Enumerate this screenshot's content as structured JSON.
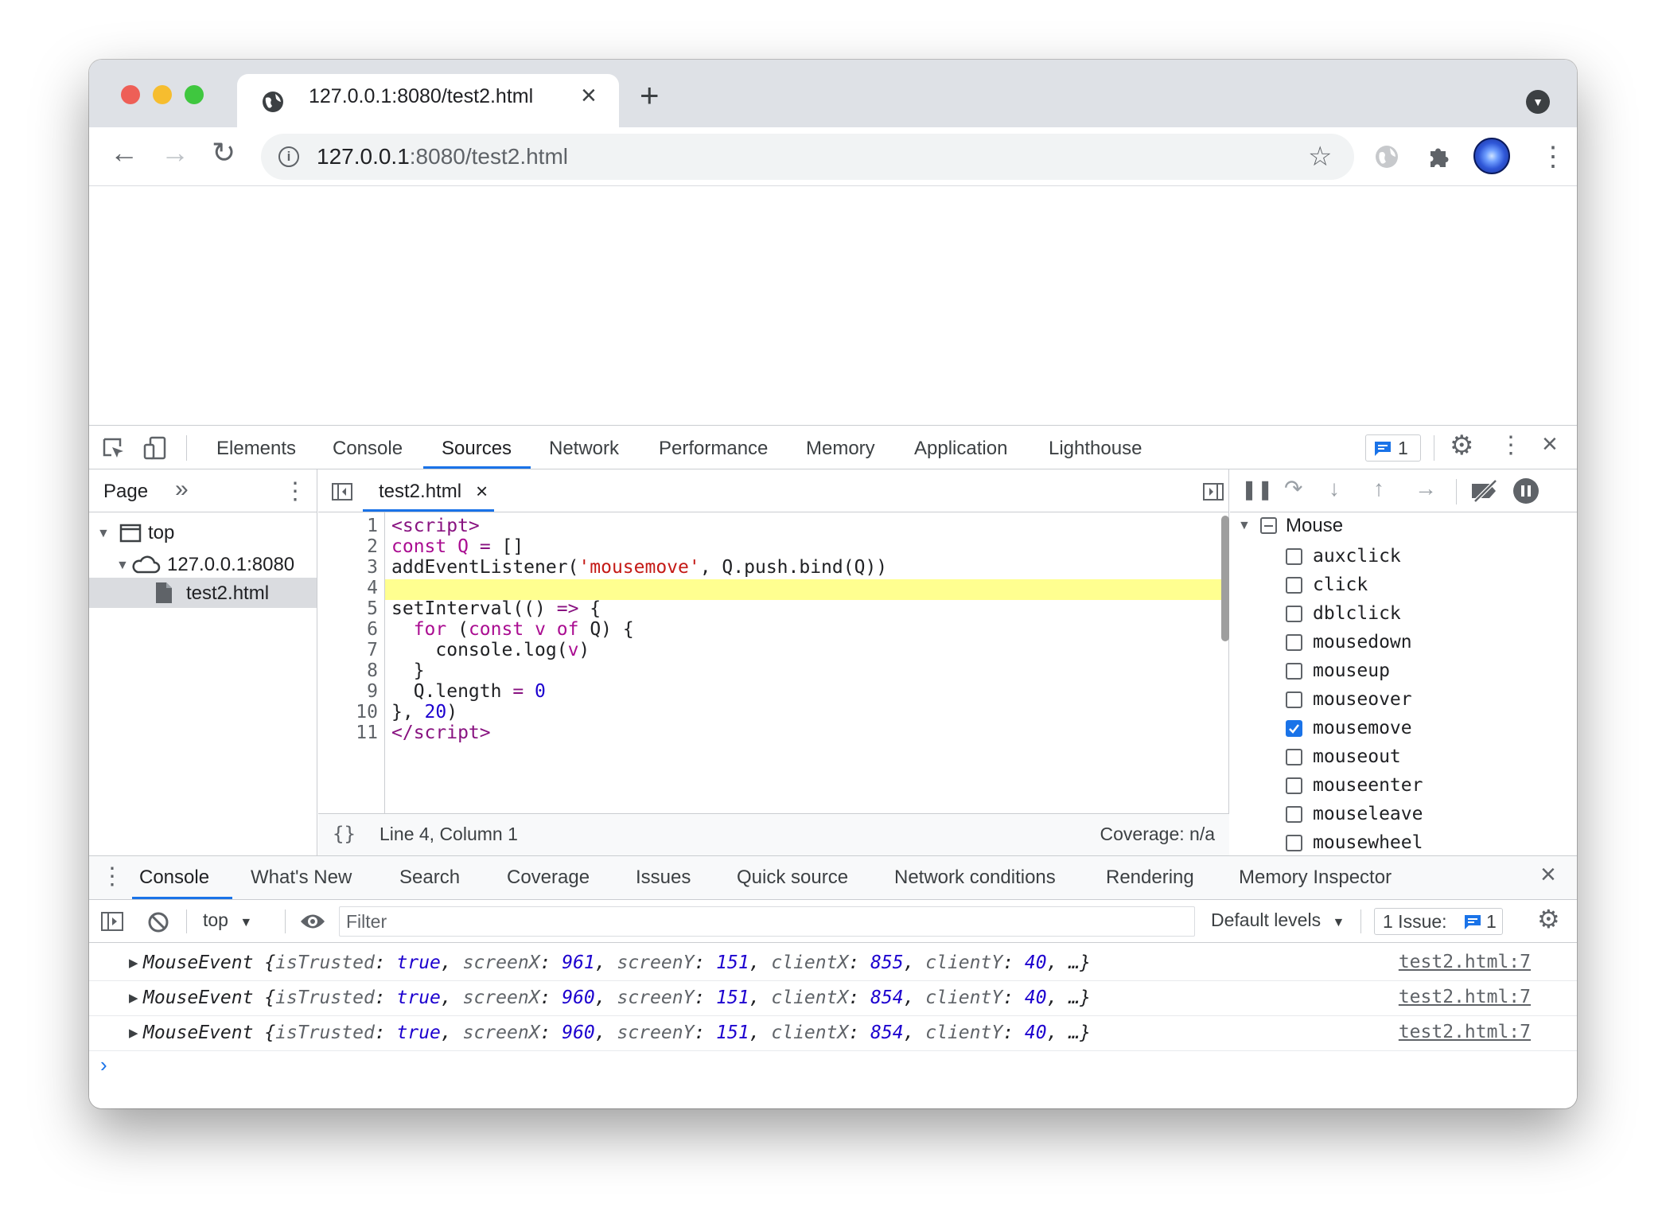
{
  "browser": {
    "tab_title": "127.0.0.1:8080/test2.html",
    "url_host": "127.0.0.1",
    "url_rest": ":8080/test2.html"
  },
  "devtools": {
    "tabs": [
      "Elements",
      "Console",
      "Sources",
      "Network",
      "Performance",
      "Memory",
      "Application",
      "Lighthouse"
    ],
    "active_tab": "Sources",
    "messages_badge": "1",
    "navigator": {
      "tab": "Page",
      "tree": [
        "top",
        "127.0.0.1:8080",
        "test2.html"
      ]
    },
    "editor": {
      "file_tab": "test2.html",
      "line_numbers": [
        "1",
        "2",
        "3",
        "4",
        "5",
        "6",
        "7",
        "8",
        "9",
        "10",
        "11"
      ],
      "status_position": "Line 4, Column 1",
      "coverage": "Coverage: n/a"
    },
    "breakpoints": {
      "group": "Mouse",
      "events": [
        {
          "name": "auxclick",
          "checked": false
        },
        {
          "name": "click",
          "checked": false
        },
        {
          "name": "dblclick",
          "checked": false
        },
        {
          "name": "mousedown",
          "checked": false
        },
        {
          "name": "mouseup",
          "checked": false
        },
        {
          "name": "mouseover",
          "checked": false
        },
        {
          "name": "mousemove",
          "checked": true
        },
        {
          "name": "mouseout",
          "checked": false
        },
        {
          "name": "mouseenter",
          "checked": false
        },
        {
          "name": "mouseleave",
          "checked": false
        },
        {
          "name": "mousewheel",
          "checked": false
        }
      ]
    },
    "drawer": {
      "tabs": [
        "Console",
        "What's New",
        "Search",
        "Coverage",
        "Issues",
        "Quick source",
        "Network conditions",
        "Rendering",
        "Memory Inspector"
      ],
      "context": "top",
      "filter_placeholder": "Filter",
      "levels": "Default levels",
      "issues": "1 Issue:",
      "issues_count": "1",
      "messages": [
        {
          "text": "MouseEvent {isTrusted: true, screenX: 961, screenY: 151, clientX: 855, clientY: 40, …}",
          "link": "test2.html:7"
        },
        {
          "text": "MouseEvent {isTrusted: true, screenX: 960, screenY: 151, clientX: 854, clientY: 40, …}",
          "link": "test2.html:7"
        },
        {
          "text": "MouseEvent {isTrusted: true, screenX: 960, screenY: 151, clientX: 854, clientY: 40, …}",
          "link": "test2.html:7"
        }
      ],
      "prompt": "›"
    }
  }
}
